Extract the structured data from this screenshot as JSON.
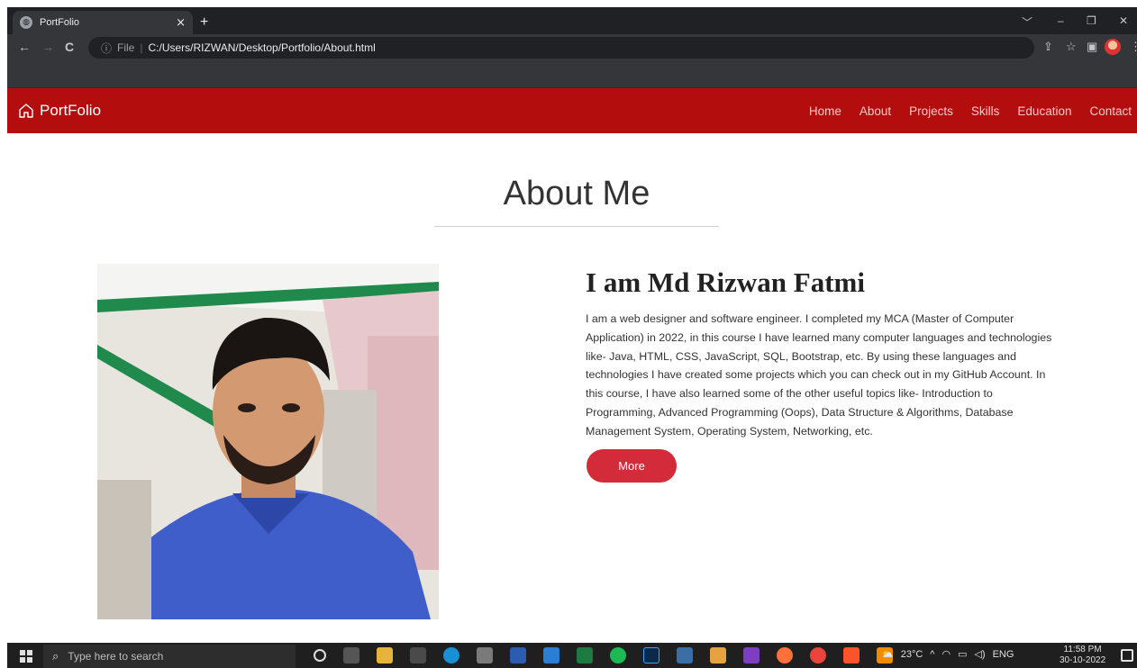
{
  "browser": {
    "tab_title": "PortFolio",
    "tab_close": "×",
    "new_tab": "+",
    "window_controls": [
      "﹀",
      "–",
      "❐",
      "✕"
    ],
    "nav": {
      "back": "←",
      "forward": "→",
      "reload": "C"
    },
    "address": {
      "info_icon": "ⓘ",
      "scheme_label": "File",
      "separator": "|",
      "url": "C:/Users/RIZWAN/Desktop/Portfolio/About.html"
    },
    "toolbar_icons": [
      "share-icon",
      "star-icon",
      "sidebar-icon",
      "profile-avatar",
      "menu-icon"
    ]
  },
  "site": {
    "brand": "PortFolio",
    "nav": [
      "Home",
      "About",
      "Projects",
      "Skills",
      "Education",
      "Contact"
    ],
    "accent_color": "#b30d0d"
  },
  "about": {
    "heading": "About Me",
    "name": "I am Md Rizwan Fatmi",
    "bio": "I am a web designer and software engineer. I completed my MCA (Master of Computer Application) in 2022, in this course I have learned many computer languages and technologies like- Java, HTML, CSS, JavaScript, SQL, Bootstrap, etc. By using these languages and technologies I have created some projects which you can check out in my GitHub Account. In this course, I have also learned some of the other useful topics like- Introduction to Programming, Advanced Programming (Oops), Data Structure & Algorithms, Database Management System, Operating System, Networking, etc.",
    "more_button": "More",
    "button_color": "#d42b3a"
  },
  "taskbar": {
    "search_placeholder": "Type here to search",
    "weather": "23°C",
    "language": "ENG",
    "time": "11:58 PM",
    "date": "30-10-2022"
  }
}
